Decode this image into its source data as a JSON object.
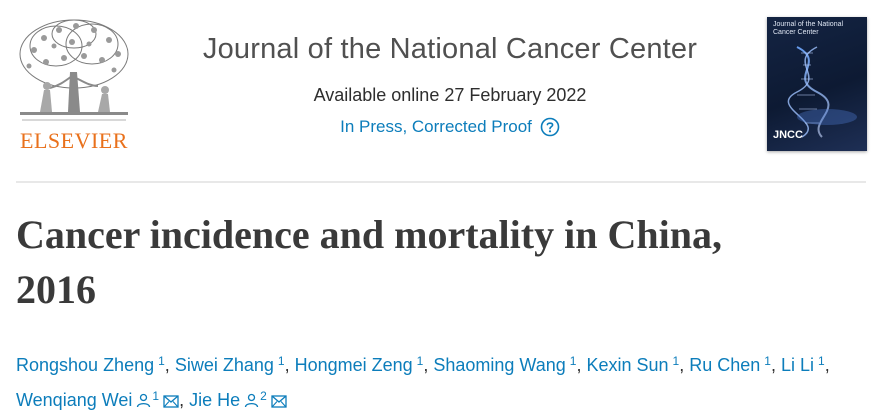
{
  "publisher": {
    "name": "ELSEVIER"
  },
  "journal": {
    "title": "Journal of the National Cancer Center",
    "available_online": "Available online 27 February 2022",
    "status_link": "In Press, Corrected Proof",
    "help_icon": "help-circle-icon"
  },
  "cover": {
    "title": "Journal of the National Cancer Center",
    "abbrev": "JNCC"
  },
  "article": {
    "title_line1": "Cancer incidence and mortality in China,",
    "title_line2": "2016"
  },
  "authors": [
    {
      "name": "Rongshou Zheng",
      "sup": "1"
    },
    {
      "name": "Siwei Zhang",
      "sup": "1"
    },
    {
      "name": "Hongmei Zeng",
      "sup": "1"
    },
    {
      "name": "Shaoming Wang",
      "sup": "1"
    },
    {
      "name": "Kexin Sun",
      "sup": "1"
    },
    {
      "name": "Ru Chen",
      "sup": "1"
    },
    {
      "name": "Li Li",
      "sup": "1"
    },
    {
      "name": "Wenqiang Wei",
      "sup": "1",
      "icons": [
        "person-icon",
        "mail-icon"
      ]
    },
    {
      "name": "Jie He",
      "sup": "2",
      "icons": [
        "person-icon",
        "mail-icon"
      ]
    }
  ],
  "colors": {
    "link": "#0c7dbb",
    "elsevier_orange": "#e9711c",
    "title_gray": "#3a3a3a"
  }
}
